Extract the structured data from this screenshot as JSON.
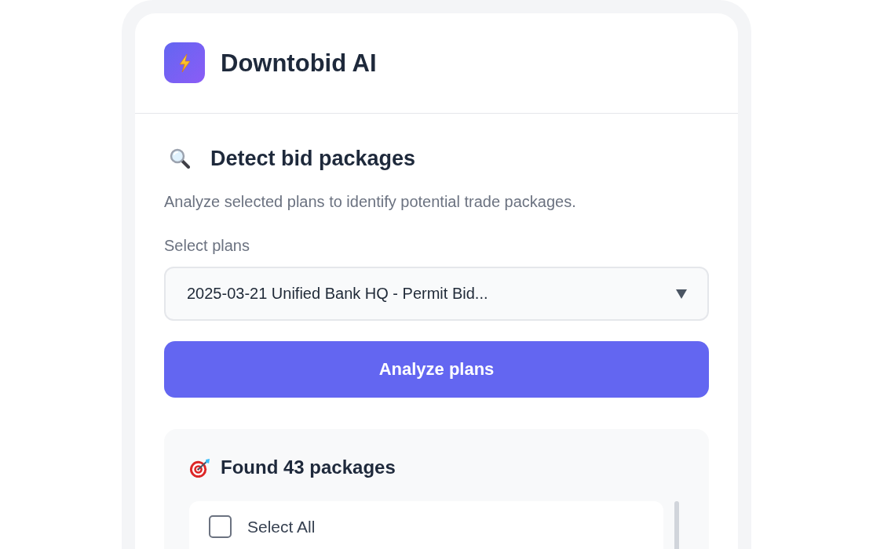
{
  "app": {
    "title": "Downtobid AI"
  },
  "detect_section": {
    "heading": "Detect bid packages",
    "description": "Analyze selected plans to identify potential trade packages.",
    "select_label": "Select plans",
    "select": {
      "value": "2025-03-21 Unified Bank HQ - Permit Bid..."
    },
    "button": "Analyze plans"
  },
  "results": {
    "heading": "Found 43 packages",
    "select_all": {
      "label": "Select All",
      "checked": false
    }
  }
}
